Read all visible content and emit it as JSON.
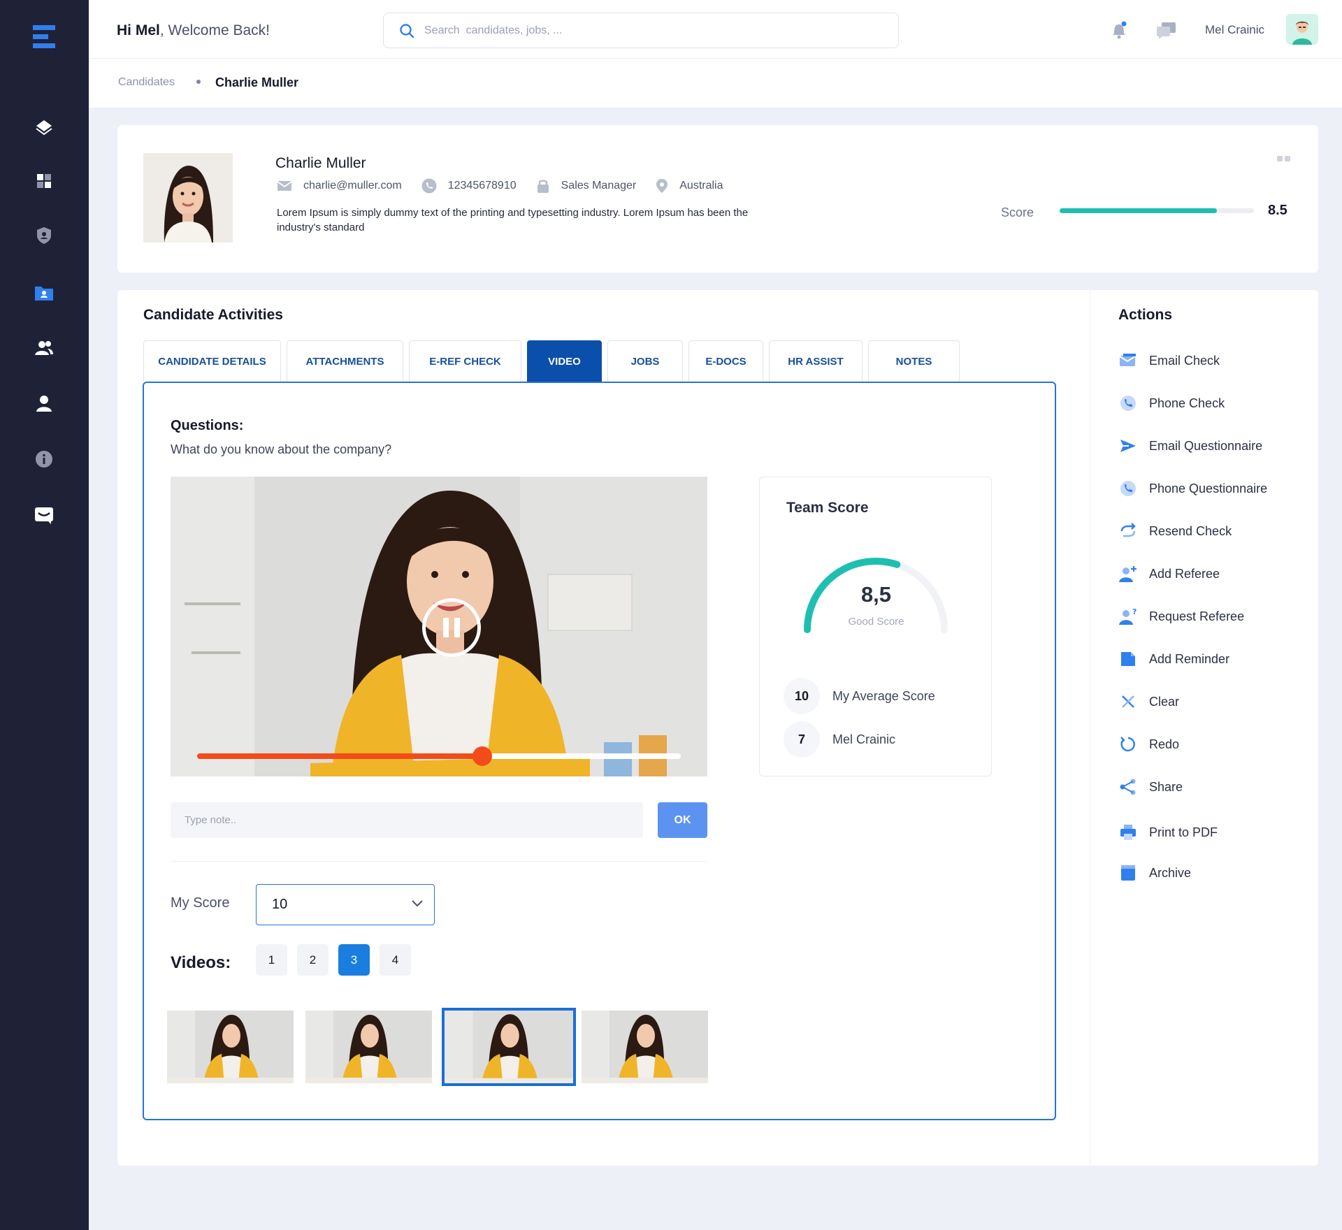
{
  "header": {
    "greeting_name": "Hi Mel",
    "greeting_rest": ", Welcome Back!",
    "search_placeholder": "Search  candidates, jobs, ...",
    "user_name": "Mel Crainic"
  },
  "breadcrumb": {
    "parent": "Candidates",
    "current": "Charlie Muller"
  },
  "profile": {
    "name": "Charlie Muller",
    "email": "charlie@muller.com",
    "phone": "12345678910",
    "role": "Sales Manager",
    "location": "Australia",
    "description": "Lorem Ipsum is simply dummy text of the printing and typesetting industry. Lorem Ipsum has been the industry's standard",
    "score_label": "Score",
    "score_value": "8.5",
    "score_fraction": 0.81
  },
  "activities": {
    "title": "Candidate Activities",
    "tabs": [
      {
        "label": "CANDIDATE DETAILS"
      },
      {
        "label": "ATTACHMENTS"
      },
      {
        "label": "E-REF CHECK"
      },
      {
        "label": "VIDEO"
      },
      {
        "label": "JOBS"
      },
      {
        "label": "E-DOCS"
      },
      {
        "label": "HR ASSIST"
      },
      {
        "label": "NOTES"
      }
    ],
    "active_tab": "VIDEO",
    "question_title": "Questions:",
    "question_text": "What do you know about the company?",
    "video_progress": 0.59,
    "note_placeholder": "Type note..",
    "ok_label": "OK",
    "my_score_label": "My Score",
    "my_score_value": "10",
    "videos_label": "Videos:",
    "video_numbers": [
      "1",
      "2",
      "3",
      "4"
    ],
    "active_video": "3"
  },
  "team_score": {
    "title": "Team Score",
    "value": "8,5",
    "label": "Good Score",
    "gauge_fraction": 0.6,
    "rows": [
      {
        "score": "10",
        "label": "My Average Score"
      },
      {
        "score": "7",
        "label": "Mel Crainic"
      }
    ],
    "accent_color": "#1ebfb1"
  },
  "actions": {
    "title": "Actions",
    "items": [
      {
        "label": "Email Check",
        "icon": "email-check-icon"
      },
      {
        "label": "Phone Check",
        "icon": "phone-check-icon"
      },
      {
        "label": "Email Questionnaire",
        "icon": "send-icon"
      },
      {
        "label": "Phone Questionnaire",
        "icon": "phone-questionnaire-icon"
      },
      {
        "label": "Resend Check",
        "icon": "resend-icon"
      },
      {
        "label": "Add Referee",
        "icon": "add-user-icon"
      },
      {
        "label": "Request Referee",
        "icon": "request-user-icon"
      },
      {
        "label": "Add Reminder",
        "icon": "reminder-icon"
      },
      {
        "label": "Clear",
        "icon": "clear-icon"
      },
      {
        "label": "Redo",
        "icon": "redo-icon"
      },
      {
        "label": "Share",
        "icon": "share-icon"
      },
      {
        "label": "Print to PDF",
        "icon": "print-icon"
      },
      {
        "label": "Archive",
        "icon": "archive-icon"
      }
    ]
  },
  "colors": {
    "sidebar": "#1f2237",
    "primary": "#0a4fab",
    "accent_blue": "#2f80ed",
    "progress": "#f44b1a",
    "teal": "#1ebfb1"
  }
}
